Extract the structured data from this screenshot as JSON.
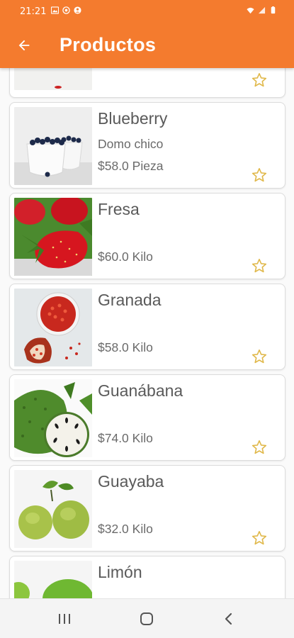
{
  "status_bar": {
    "time": "21:21"
  },
  "app_bar": {
    "title": "Productos"
  },
  "products": [
    {
      "name": "Blueberry",
      "description": "Domo chico",
      "price": "$58.0 Pieza",
      "image": "blueberry-image"
    },
    {
      "name": "Fresa",
      "description": "",
      "price": "$60.0 Kilo",
      "image": "strawberry-image"
    },
    {
      "name": "Granada",
      "description": "",
      "price": "$58.0 Kilo",
      "image": "pomegranate-image"
    },
    {
      "name": "Guanábana",
      "description": "",
      "price": "$74.0 Kilo",
      "image": "soursop-image"
    },
    {
      "name": "Guayaba",
      "description": "",
      "price": "$32.0 Kilo",
      "image": "guava-image"
    },
    {
      "name": "Limón",
      "description": "",
      "price": "",
      "image": "lime-image"
    }
  ],
  "colors": {
    "primary": "#f47b2e",
    "star": "#e0b84a"
  },
  "icons": {
    "back": "arrow-back-icon",
    "favorite": "star-outline-icon",
    "recents": "recents-icon",
    "home": "home-icon",
    "nav_back": "chevron-left-icon"
  }
}
